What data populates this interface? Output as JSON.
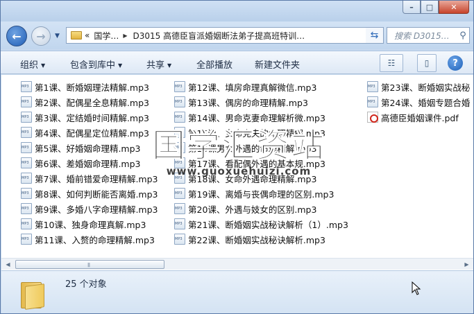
{
  "window": {
    "caption_buttons": {
      "minimize": "–",
      "maximize": "□",
      "close": "✕"
    }
  },
  "nav": {
    "back_glyph": "←",
    "forward_glyph": "→",
    "breadcrumb": [
      "«",
      "国学…",
      "D3015 高德臣盲派婚姻断法弟子提高班特训…"
    ],
    "search_placeholder": "搜索 D3015…"
  },
  "toolbar": {
    "organize": "组织",
    "include_in_library": "包含到库中",
    "share": "共享",
    "play_all": "全部播放",
    "new_folder": "新建文件夹"
  },
  "files": {
    "col1": [
      "第1课、断婚姻理法精解.mp3",
      "第2课、配偶星全息精解.mp3",
      "第3课、定结婚时间精解.mp3",
      "第4课、配偶星定位精解.mp3",
      "第5课、好婚姻命理精.mp3",
      "第6课、差婚姻命理精.mp3",
      "第7课、婚前错爱命理精解.mp3",
      "第8课、如何判断能否离婚.mp3",
      "第9课、多婚八字命理精解.mp3",
      "第10课、独身命理真解.mp3",
      "第11课、入赘的命理精解.mp3"
    ],
    "col2": [
      "第12课、填房命理真解微信.mp3",
      "第13课、偶房的命理精解.mp3",
      "第14课、男命克妻命理解析微.mp3",
      "第15课、女命克夫的命理精解.mp3",
      "第16课男女外遇的命理精解.mp3",
      "第17课、看配偶外遇的基本规.mp3",
      "第18课、女命外遇命理精解.mp3",
      "第19课、离婚与丧偶命理的区别.mp3",
      "第20课、外遇与妓女的区别.mp3",
      "第21课、断婚姻实战秘诀解析（1）.mp3",
      "第22课、断婚姻实战秘诀解析.mp3"
    ],
    "col3": [
      "第23课、断婚姻实战秘",
      "第24课、婚姻专题合婚",
      "高德臣婚姻课件.pdf"
    ]
  },
  "watermark": {
    "text": "国学汇资站",
    "url": "www.guoxuehuizi.com"
  },
  "details": {
    "item_count": "25 个对象"
  }
}
